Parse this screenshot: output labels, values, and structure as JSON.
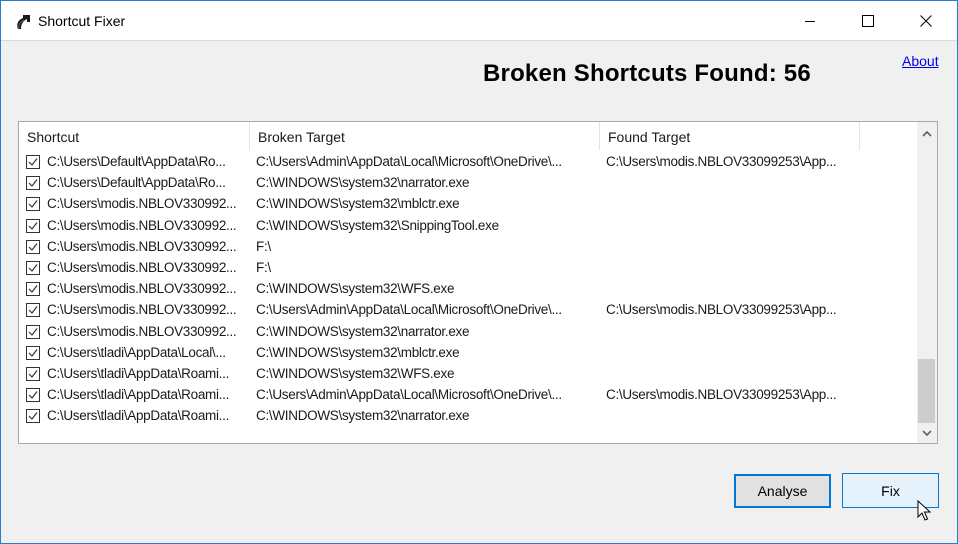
{
  "window": {
    "title": "Shortcut Fixer",
    "controls": {
      "minimize_icon": "minimize-icon",
      "maximize_icon": "maximize-icon",
      "close_icon": "close-icon"
    }
  },
  "header": {
    "about_link": "About",
    "headline": "Broken Shortcuts Found: 56",
    "broken_count": 56
  },
  "list": {
    "columns": [
      "Shortcut",
      "Broken Target",
      "Found Target",
      ""
    ],
    "rows": [
      {
        "checked": true,
        "shortcut": "C:\\Users\\Default\\AppData\\Ro...",
        "broken_target": "C:\\Users\\Admin\\AppData\\Local\\Microsoft\\OneDrive\\...",
        "found_target": "C:\\Users\\modis.NBLOV33099253\\App..."
      },
      {
        "checked": true,
        "shortcut": "C:\\Users\\Default\\AppData\\Ro...",
        "broken_target": "C:\\WINDOWS\\system32\\narrator.exe",
        "found_target": ""
      },
      {
        "checked": true,
        "shortcut": "C:\\Users\\modis.NBLOV330992...",
        "broken_target": "C:\\WINDOWS\\system32\\mblctr.exe",
        "found_target": ""
      },
      {
        "checked": true,
        "shortcut": "C:\\Users\\modis.NBLOV330992...",
        "broken_target": "C:\\WINDOWS\\system32\\SnippingTool.exe",
        "found_target": ""
      },
      {
        "checked": true,
        "shortcut": "C:\\Users\\modis.NBLOV330992...",
        "broken_target": "F:\\",
        "found_target": ""
      },
      {
        "checked": true,
        "shortcut": "C:\\Users\\modis.NBLOV330992...",
        "broken_target": "F:\\",
        "found_target": ""
      },
      {
        "checked": true,
        "shortcut": "C:\\Users\\modis.NBLOV330992...",
        "broken_target": "C:\\WINDOWS\\system32\\WFS.exe",
        "found_target": ""
      },
      {
        "checked": true,
        "shortcut": "C:\\Users\\modis.NBLOV330992...",
        "broken_target": "C:\\Users\\Admin\\AppData\\Local\\Microsoft\\OneDrive\\...",
        "found_target": "C:\\Users\\modis.NBLOV33099253\\App..."
      },
      {
        "checked": true,
        "shortcut": "C:\\Users\\modis.NBLOV330992...",
        "broken_target": "C:\\WINDOWS\\system32\\narrator.exe",
        "found_target": ""
      },
      {
        "checked": true,
        "shortcut": "C:\\Users\\tladi\\AppData\\Local\\...",
        "broken_target": "C:\\WINDOWS\\system32\\mblctr.exe",
        "found_target": ""
      },
      {
        "checked": true,
        "shortcut": "C:\\Users\\tladi\\AppData\\Roami...",
        "broken_target": "C:\\WINDOWS\\system32\\WFS.exe",
        "found_target": ""
      },
      {
        "checked": true,
        "shortcut": "C:\\Users\\tladi\\AppData\\Roami...",
        "broken_target": "C:\\Users\\Admin\\AppData\\Local\\Microsoft\\OneDrive\\...",
        "found_target": "C:\\Users\\modis.NBLOV33099253\\App..."
      },
      {
        "checked": true,
        "shortcut": "C:\\Users\\tladi\\AppData\\Roami...",
        "broken_target": "C:\\WINDOWS\\system32\\narrator.exe",
        "found_target": ""
      }
    ]
  },
  "buttons": {
    "analyse": "Analyse",
    "fix": "Fix"
  },
  "colors": {
    "accent": "#0078d7",
    "link": "#0000ee",
    "window_border": "#2b7bd1"
  }
}
